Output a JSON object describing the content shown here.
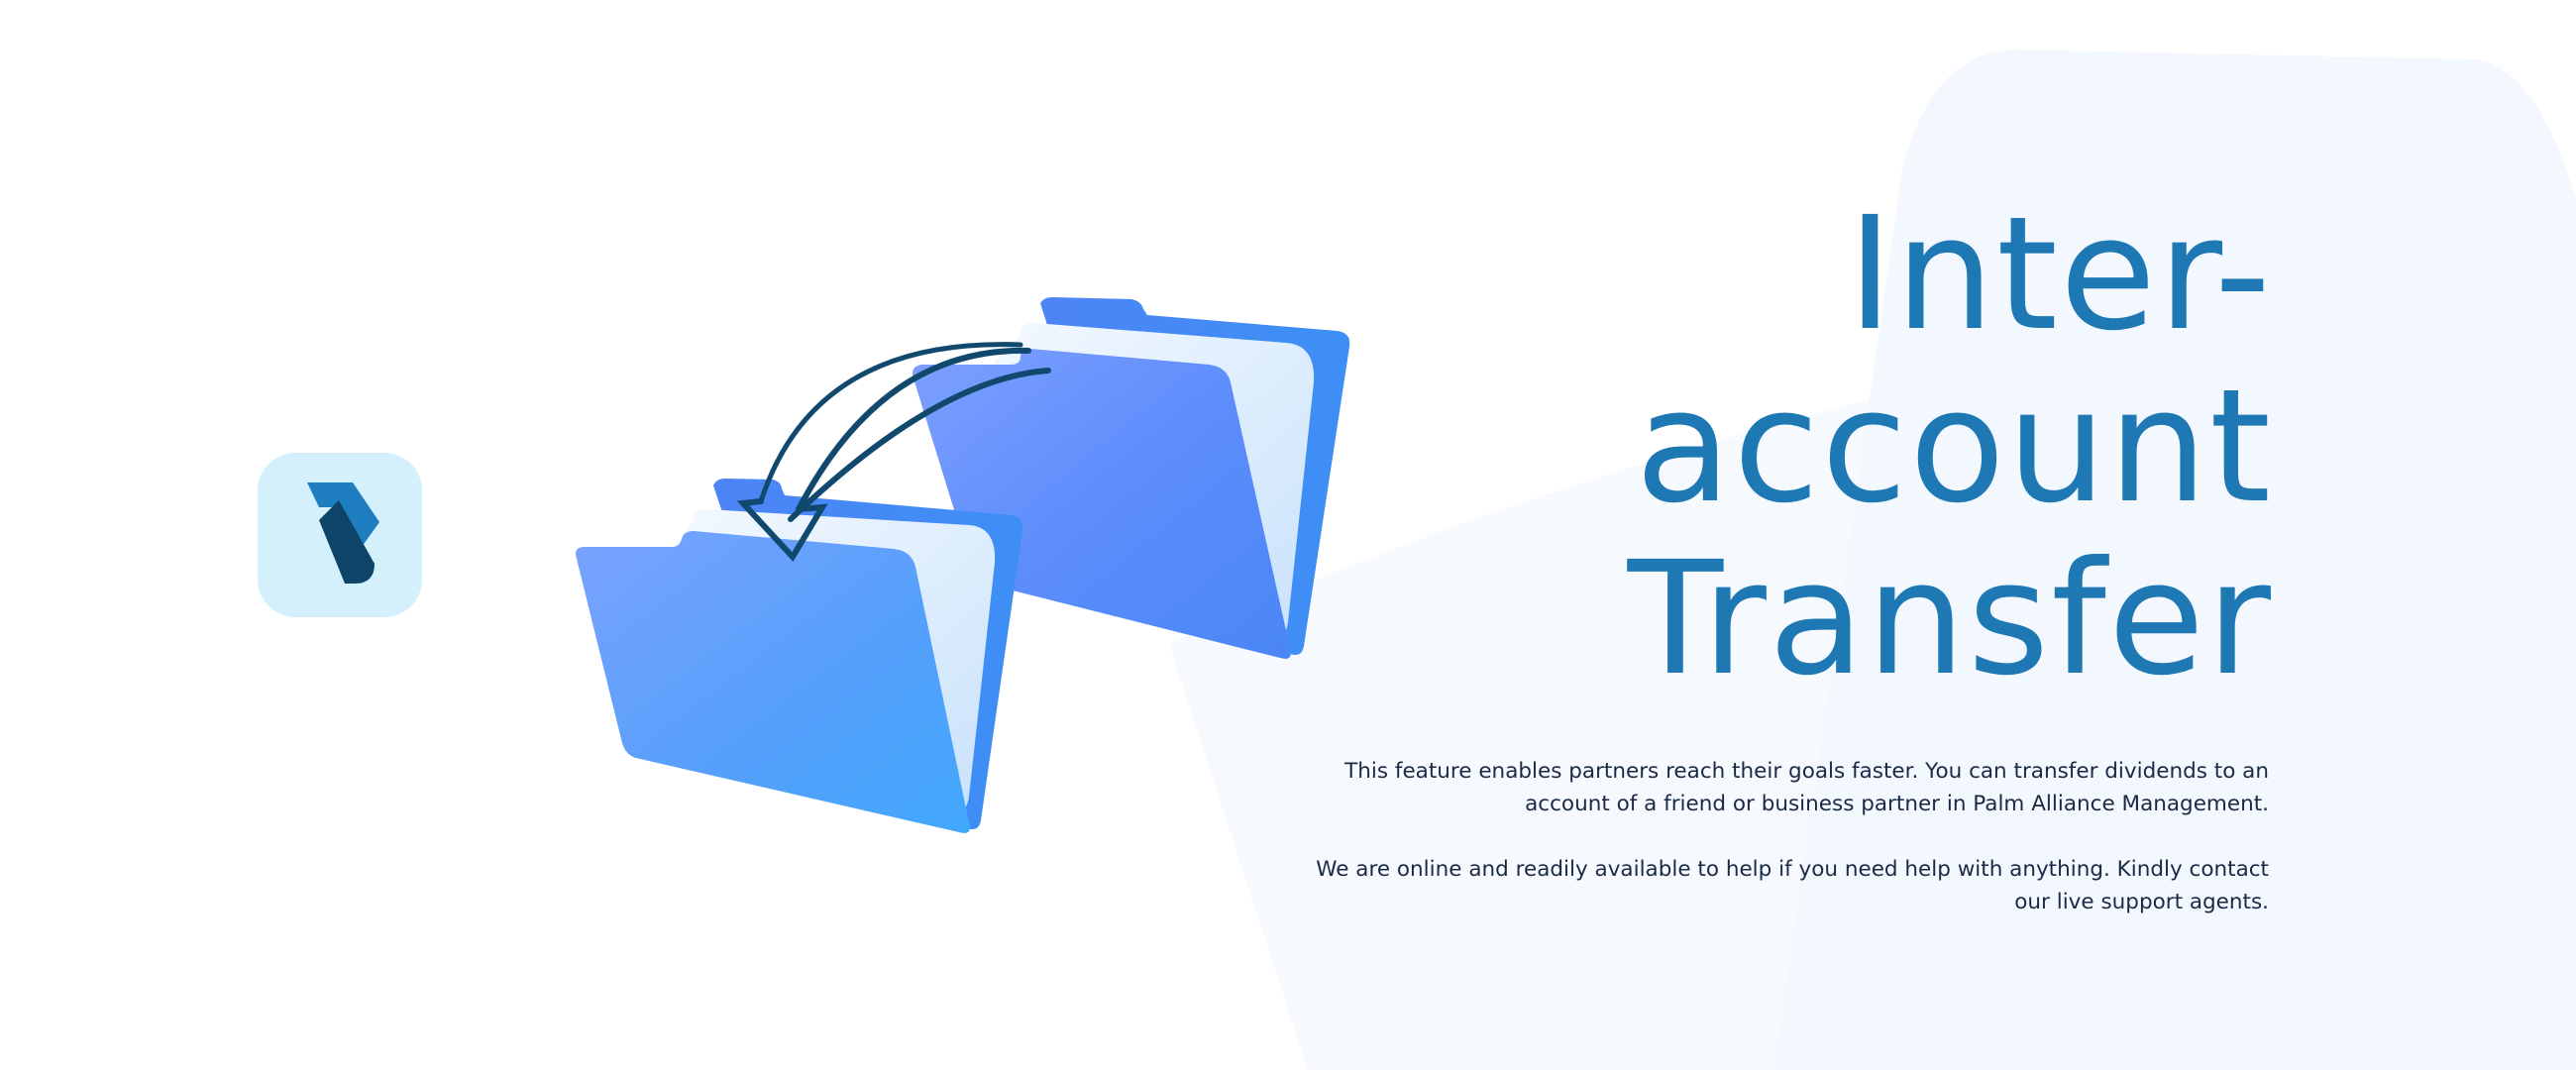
{
  "brand": {
    "logo_icon": "palm-alliance-logo-icon",
    "tile_color": "#d4f0fc",
    "mark_light": "#1e7ec0",
    "mark_dark": "#0d4468"
  },
  "illustration": {
    "icons": [
      "folder-icon",
      "transfer-arrow-icon"
    ],
    "folder_color": "#4f8efc",
    "arrow_color": "#11496e"
  },
  "headline": {
    "line1": "Inter-",
    "line2": "account",
    "line3": "Transfer",
    "color": "#1d78b4"
  },
  "description": {
    "paragraph1": "This feature enables partners reach their goals faster. You can transfer dividends to an account of a friend or business partner in Palm Alliance Management.",
    "paragraph2": "We are online and readily available to help if you need help with anything. Kindly contact our live support agents.",
    "color": "#1a2a45"
  },
  "background": {
    "base": "#ffffff",
    "shape": "#f3f7fe"
  }
}
